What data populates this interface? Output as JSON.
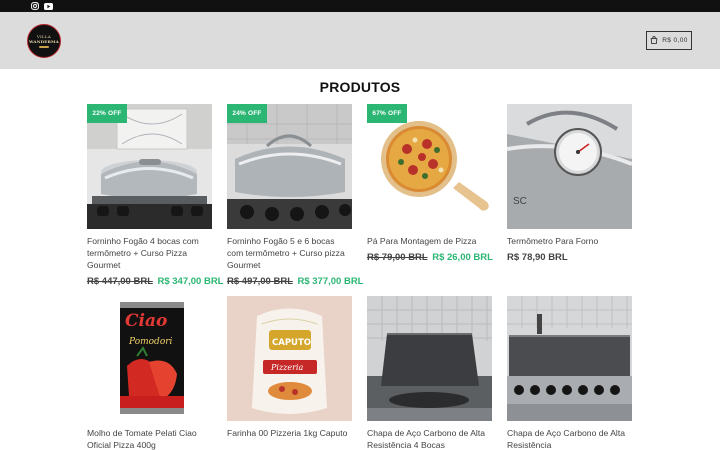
{
  "topbar": {
    "social": [
      "instagram-icon",
      "youtube-icon"
    ]
  },
  "header": {
    "logo_line1": "VILLA",
    "logo_line2": "WANDERMA",
    "cart_label": "R$ 0,00"
  },
  "section": {
    "title": "PRODUTOS"
  },
  "colors": {
    "accent": "#2bb673",
    "header_bg": "#dcdcdc",
    "topbar_bg": "#111111"
  },
  "products": [
    {
      "name": "Forninho Fogão 4 bocas com termômetro + Curso Pizza Gourmet",
      "badge": "22% OFF",
      "old_price": "R$ 447,00 BRL",
      "price": "R$ 347,00 BRL"
    },
    {
      "name": "Forninho Fogão 5 e 6 bocas com termômetro + Curso pizza Gourmet",
      "badge": "24% OFF",
      "old_price": "R$ 497,00 BRL",
      "price": "R$ 377,00 BRL"
    },
    {
      "name": "Pá Para Montagem de Pizza",
      "badge": "67% OFF",
      "old_price": "R$ 79,00 BRL",
      "price": "R$ 26,00 BRL"
    },
    {
      "name": "Termômetro Para Forno",
      "badge": "",
      "old_price": "",
      "price": "R$ 78,90 BRL"
    },
    {
      "name": "Molho de Tomate Pelati Ciao Oficial Pizza 400g",
      "badge": "",
      "old_price": "",
      "price": ""
    },
    {
      "name": "Farinha 00 Pizzeria 1kg Caputo",
      "badge": "",
      "old_price": "",
      "price": ""
    },
    {
      "name": "Chapa de Aço Carbono de Alta Resistência 4 Bocas",
      "badge": "",
      "old_price": "",
      "price": ""
    },
    {
      "name": "Chapa de Aço Carbono de Alta Resistência",
      "badge": "",
      "old_price": "",
      "price": ""
    }
  ],
  "product_images": {
    "ciao_brand": "Ciao",
    "ciao_sub": "Pomodori",
    "caputo_brand": "CAPUTO",
    "caputo_sub": "Pizzeria"
  }
}
